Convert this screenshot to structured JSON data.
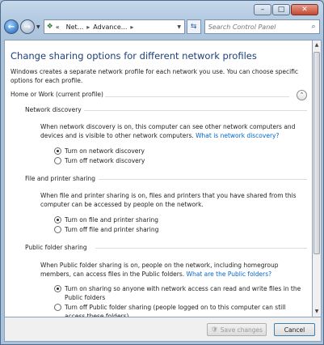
{
  "window": {
    "minimize_label": "–",
    "maximize_label": "□",
    "close_label": "✕"
  },
  "addressbar": {
    "back_glyph": "←",
    "forward_glyph": "→",
    "chevrons": "«",
    "crumbs": [
      "Net...",
      "Advance..."
    ],
    "crumb_separator": "▸",
    "search_placeholder": "Search Control Panel"
  },
  "page": {
    "title": "Change sharing options for different network profiles",
    "description": "Windows creates a separate network profile for each network you use. You can choose specific options for each profile.",
    "profile_label": "Home or Work (current profile)"
  },
  "sections": {
    "discovery": {
      "heading": "Network discovery",
      "text": "When network discovery is on, this computer can see other network computers and devices and is visible to other network computers.",
      "link": "What is network discovery?",
      "options": [
        "Turn on network discovery",
        "Turn off network discovery"
      ],
      "selected": 0
    },
    "file_printer": {
      "heading": "File and printer sharing",
      "text": "When file and printer sharing is on, files and printers that you have shared from this computer can be accessed by people on the network.",
      "options": [
        "Turn on file and printer sharing",
        "Turn off file and printer sharing"
      ],
      "selected": 0
    },
    "public_folder": {
      "heading": "Public folder sharing",
      "text": "When Public folder sharing is on, people on the network, including homegroup members, can access files in the Public folders.",
      "link": "What are the Public folders?",
      "options": [
        "Turn on sharing so anyone with network access can read and write files in the Public folders",
        "Turn off Public folder sharing (people logged on to this computer can still access these folders)"
      ],
      "selected": 0
    }
  },
  "footer": {
    "save_label": "Save changes",
    "cancel_label": "Cancel"
  }
}
